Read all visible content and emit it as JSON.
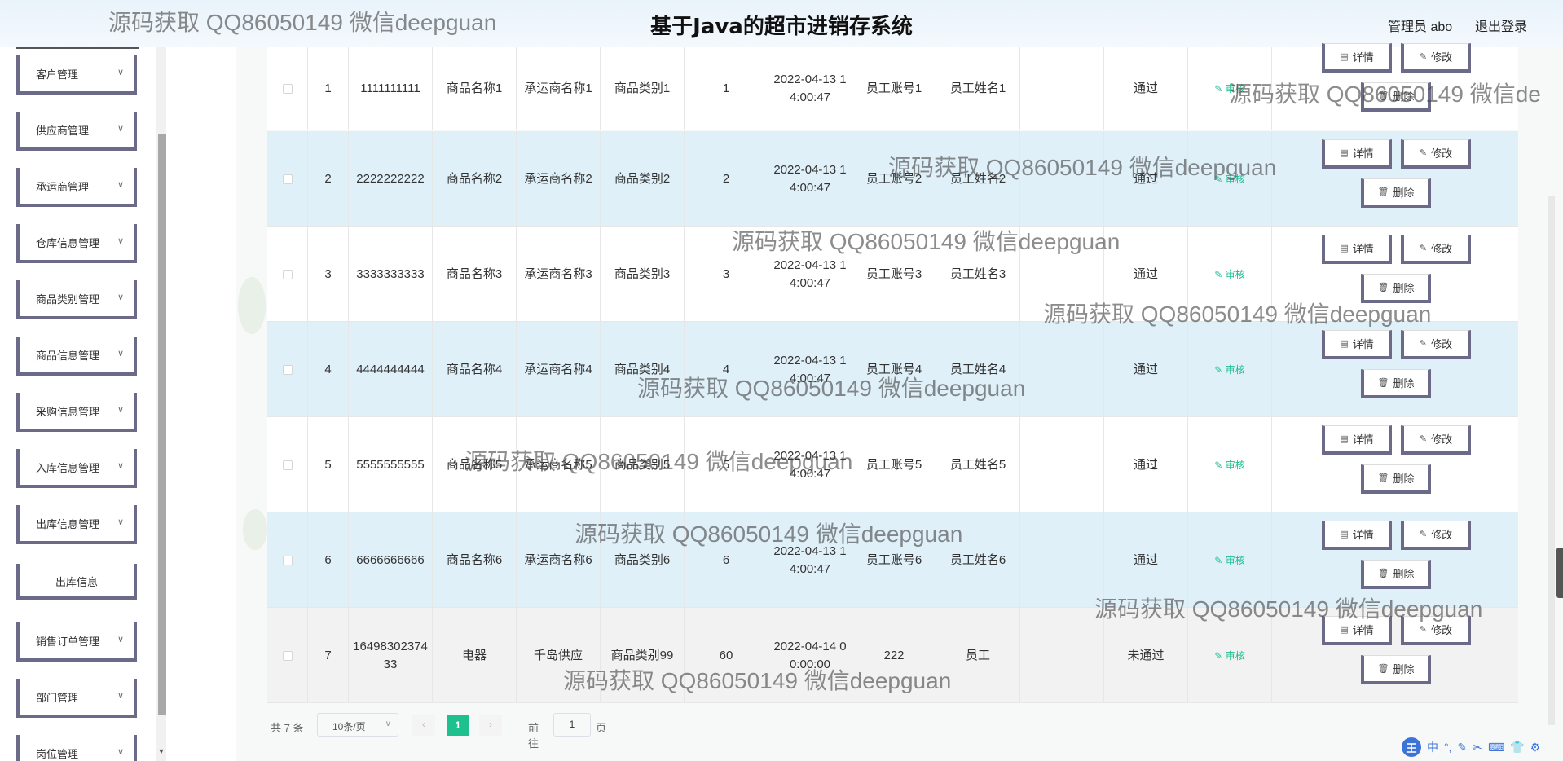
{
  "header": {
    "title": "基于Java的超市进销存系统",
    "admin": "管理员 abo",
    "logout": "退出登录"
  },
  "sidebar": {
    "items": [
      {
        "label": "客户管理",
        "chevron": "chevron-down-icon"
      },
      {
        "label": "供应商管理",
        "chevron": "chevron-down-icon"
      },
      {
        "label": "承运商管理",
        "chevron": "chevron-down-icon"
      },
      {
        "label": "仓库信息管理",
        "chevron": "chevron-down-icon"
      },
      {
        "label": "商品类别管理",
        "chevron": "chevron-down-icon"
      },
      {
        "label": "商品信息管理",
        "chevron": "chevron-down-icon"
      },
      {
        "label": "采购信息管理",
        "chevron": "chevron-down-icon"
      },
      {
        "label": "入库信息管理",
        "chevron": "chevron-down-icon"
      },
      {
        "label": "出库信息管理",
        "chevron": "chevron-down-icon"
      },
      {
        "label": "销售订单管理",
        "chevron": "chevron-down-icon"
      },
      {
        "label": "部门管理",
        "chevron": "chevron-down-icon"
      },
      {
        "label": "岗位管理",
        "chevron": "chevron-down-icon"
      }
    ],
    "sub_item": "出库信息"
  },
  "table": {
    "audit_label": "审核",
    "buttons": {
      "detail": "详情",
      "edit": "修改",
      "delete": "删除"
    },
    "rows": [
      {
        "idx": "1",
        "code": "1111111111",
        "name": "商品名称1",
        "carrier": "承运商名称1",
        "category": "商品类别1",
        "qty": "1",
        "time": "2022-04-13 14:00:47",
        "account": "员工账号1",
        "staff": "员工姓名1",
        "remark": "",
        "status": "通过"
      },
      {
        "idx": "2",
        "code": "2222222222",
        "name": "商品名称2",
        "carrier": "承运商名称2",
        "category": "商品类别2",
        "qty": "2",
        "time": "2022-04-13 14:00:47",
        "account": "员工账号2",
        "staff": "员工姓名2",
        "remark": "",
        "status": "通过"
      },
      {
        "idx": "3",
        "code": "3333333333",
        "name": "商品名称3",
        "carrier": "承运商名称3",
        "category": "商品类别3",
        "qty": "3",
        "time": "2022-04-13 14:00:47",
        "account": "员工账号3",
        "staff": "员工姓名3",
        "remark": "",
        "status": "通过"
      },
      {
        "idx": "4",
        "code": "4444444444",
        "name": "商品名称4",
        "carrier": "承运商名称4",
        "category": "商品类别4",
        "qty": "4",
        "time": "2022-04-13 14:00:47",
        "account": "员工账号4",
        "staff": "员工姓名4",
        "remark": "",
        "status": "通过"
      },
      {
        "idx": "5",
        "code": "5555555555",
        "name": "商品名称5",
        "carrier": "承运商名称5",
        "category": "商品类别5",
        "qty": "5",
        "time": "2022-04-13 14:00:47",
        "account": "员工账号5",
        "staff": "员工姓名5",
        "remark": "",
        "status": "通过"
      },
      {
        "idx": "6",
        "code": "6666666666",
        "name": "商品名称6",
        "carrier": "承运商名称6",
        "category": "商品类别6",
        "qty": "6",
        "time": "2022-04-13 14:00:47",
        "account": "员工账号6",
        "staff": "员工姓名6",
        "remark": "",
        "status": "通过"
      },
      {
        "idx": "7",
        "code": "1649830237433",
        "name": "电器",
        "carrier": "千岛供应",
        "category": "商品类别99",
        "qty": "60",
        "time": "2022-04-14 00:00:00",
        "account": "222",
        "staff": "员工",
        "remark": "",
        "status": "未通过"
      }
    ]
  },
  "pagination": {
    "total": "共 7 条",
    "page_size": "10条/页",
    "prev": "‹",
    "next": "›",
    "current": "1",
    "goto_label": "前往",
    "goto_value": "1",
    "unit": "页"
  },
  "watermark": "源码获取 QQ86050149 微信deepguan",
  "watermark_partial": "源码获取 QQ86050149 微信de",
  "ime": {
    "badge": "王",
    "symbols": [
      "中",
      "°,",
      "✎",
      "✂",
      "⌨",
      "👕",
      "⚙"
    ]
  }
}
